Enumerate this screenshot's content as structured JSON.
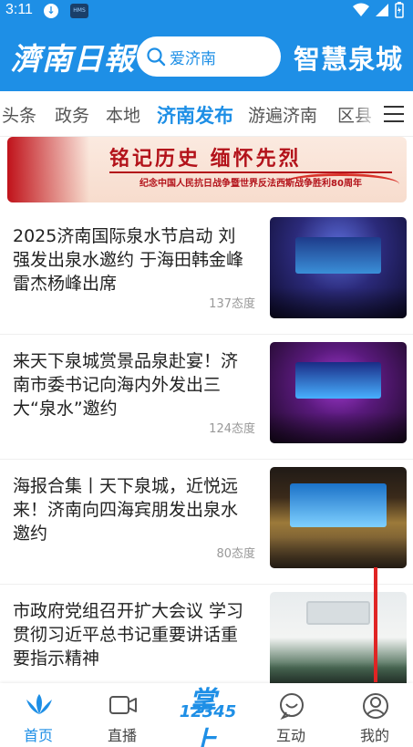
{
  "status_bar": {
    "time": "3:11",
    "download_badge": "↓",
    "hms_badge": "HMS",
    "icons": [
      "wifi-icon",
      "signal-icon",
      "battery-icon"
    ]
  },
  "header": {
    "logo": "濟南日報",
    "search_placeholder": "爱济南",
    "brand": "智慧泉城"
  },
  "tabs": [
    "头条",
    "政务",
    "本地",
    "济南发布",
    "游遍济南",
    "区县"
  ],
  "active_tab": "济南发布",
  "banner": {
    "title": "铭记历史 缅怀先烈",
    "subtitle": "纪念中国人民抗日战争暨世界反法西斯战争胜利80周年"
  },
  "news": [
    {
      "title": "2025济南国际泉水节启动 刘强发出泉水邀约 于海田韩金峰雷杰杨峰出席",
      "meta": "137态度"
    },
    {
      "title": "来天下泉城赏景品泉赴宴！济南市委书记向海内外发出三大“泉水”邀约",
      "meta": "124态度"
    },
    {
      "title": "海报合集丨天下泉城，近悦远来！济南向四海宾朋发出泉水邀约",
      "meta": "80态度"
    },
    {
      "title": "市政府党组召开扩大会议 学习贯彻习近平总书记重要讲话重要指示精神",
      "meta": ""
    }
  ],
  "bottom_nav": {
    "home": "首页",
    "live": "直播",
    "center_big": "掌上",
    "center_small": "12345",
    "interact": "互动",
    "mine": "我的"
  },
  "colors": {
    "brand_blue": "#1e8fe6",
    "banner_red": "#b3121a",
    "annotation_red": "#e02424"
  }
}
